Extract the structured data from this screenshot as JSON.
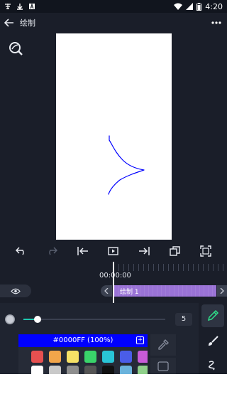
{
  "status_bar": {
    "time": "4:20"
  },
  "header": {
    "title": "绘制"
  },
  "timeline": {
    "time": "00:00:00",
    "clip_label": "绘制 1"
  },
  "brush": {
    "size": "5",
    "size_fraction": 0.1
  },
  "color": {
    "hex_label": "#0000FF (100%)",
    "current": "#0000FF"
  },
  "palette": [
    "#e65050",
    "#f2a54a",
    "#f5e166",
    "#39d46a",
    "#29c5d6",
    "#4a5de8",
    "#c85bd8",
    "#ffffff",
    "#c9c9c9",
    "#8e8e8e",
    "#555555",
    "#111111",
    "#6ab3dc",
    "#8fd08a"
  ],
  "icons": {
    "back": "arrow-left-icon",
    "more": "more-horizontal-icon",
    "zoom": "zoom-fit-icon",
    "undo": "undo-icon",
    "redo": "redo-icon",
    "to_start": "skip-to-start-icon",
    "play": "play-icon",
    "to_end": "skip-to-end-icon",
    "copy": "duplicate-icon",
    "fullscreen": "fullscreen-icon",
    "eye": "eye-icon",
    "pencil": "pencil-icon",
    "brush": "brush-icon",
    "squiggle": "squiggle-icon",
    "eyedropper": "eyedropper-icon",
    "layer": "layer-icon"
  }
}
